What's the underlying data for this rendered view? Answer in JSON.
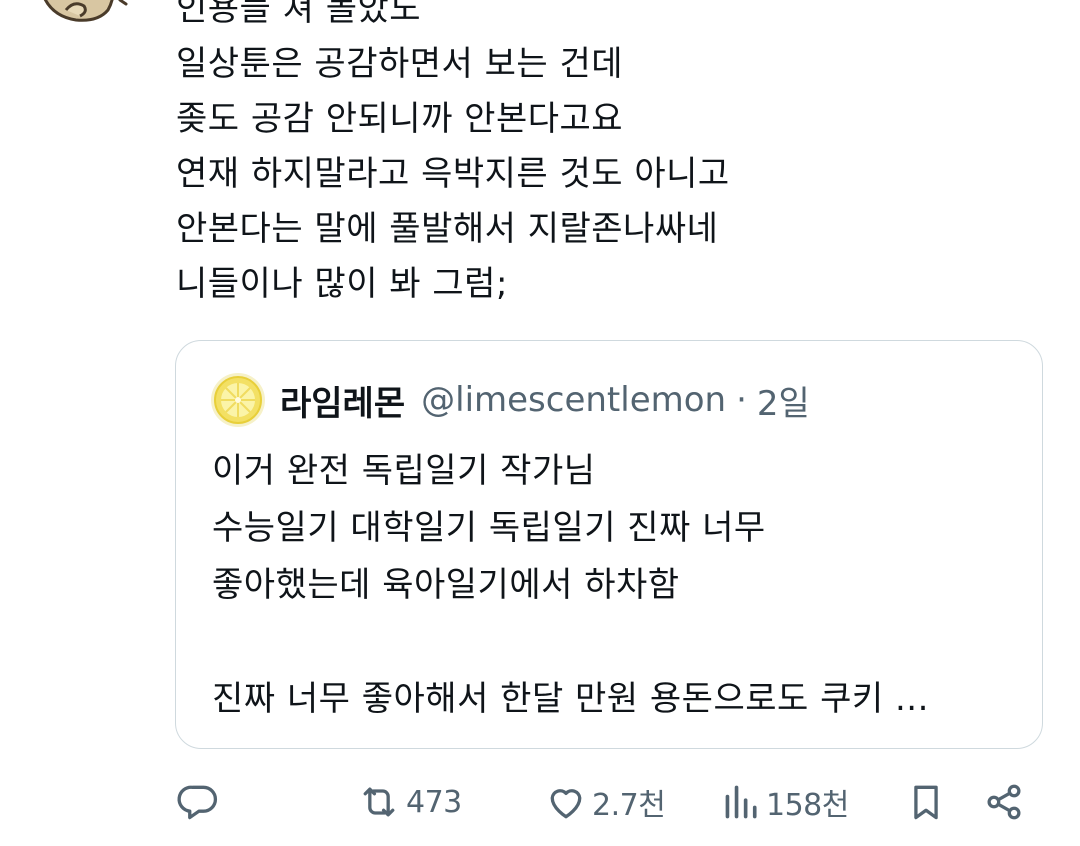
{
  "tweet": {
    "lines": [
      "인용들 쳐 돌았노",
      "일상툰은 공감하면서 보는 건데",
      "좆도 공감 안되니까 안본다고요",
      "연재 하지말라고 윽박지른 것도 아니고",
      "안본다는 말에 풀발해서 지랄존나싸네",
      "니들이나 많이 봐 그럼;"
    ]
  },
  "quote": {
    "name": "라임레몬",
    "handle": "@limescentlemon",
    "separator": "·",
    "time": "2일",
    "lines": [
      "이거 완전 독립일기 작가님",
      "수능일기 대학일기 독립일기 진짜 너무",
      "좋아했는데 육아일기에서 하차함",
      "",
      "진짜 너무 좋아해서 한달 만원 용돈으로도 쿠키 ..."
    ]
  },
  "actions": {
    "reply_icon": "reply-icon",
    "retweet_icon": "retweet-icon",
    "retweet_count": "473",
    "like_icon": "heart-icon",
    "like_count": "2.7천",
    "views_icon": "views-chart-icon",
    "views_count": "158천",
    "bookmark_icon": "bookmark-icon",
    "share_icon": "share-icon"
  },
  "colors": {
    "text": "#0f1419",
    "secondary": "#536471",
    "border": "#cfd9de"
  }
}
